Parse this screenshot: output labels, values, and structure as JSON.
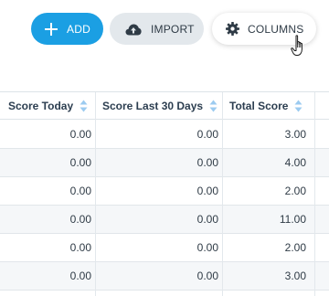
{
  "toolbar": {
    "add": {
      "label": "ADD",
      "icon": "plus-icon"
    },
    "import": {
      "label": "IMPORT",
      "icon": "cloud-upload-icon"
    },
    "columns": {
      "label": "COLUMNS",
      "icon": "gear-icon"
    }
  },
  "colors": {
    "accent": "#1b9fe3",
    "secondary_button": "#e3e8ec",
    "sort_icon": "#9ccbf0",
    "alt_row": "#f5f7f9"
  },
  "table": {
    "columns": [
      {
        "label": "Score Today",
        "sort_icon": "sort-icon"
      },
      {
        "label": "Score Last 30 Days",
        "sort_icon": "sort-icon"
      },
      {
        "label": "Total Score",
        "sort_icon": "sort-icon"
      }
    ],
    "rows": [
      [
        "0.00",
        "0.00",
        "3.00"
      ],
      [
        "0.00",
        "0.00",
        "4.00"
      ],
      [
        "0.00",
        "0.00",
        "2.00"
      ],
      [
        "0.00",
        "0.00",
        "11.00"
      ],
      [
        "0.00",
        "0.00",
        "2.00"
      ],
      [
        "0.00",
        "0.00",
        "3.00"
      ]
    ]
  }
}
